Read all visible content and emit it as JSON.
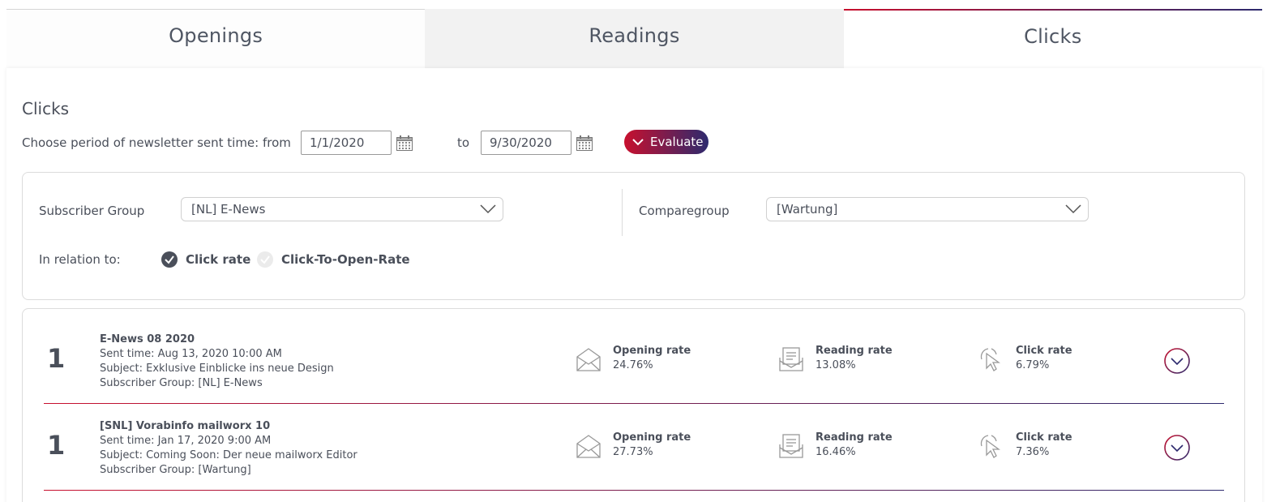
{
  "tabs": [
    {
      "label": "Openings"
    },
    {
      "label": "Readings"
    },
    {
      "label": "Clicks"
    }
  ],
  "page_title": "Clicks",
  "period": {
    "label": "Choose period of newsletter sent time:",
    "from_label": "from",
    "from_value": "1/1/2020",
    "to_label": "to",
    "to_value": "9/30/2020",
    "evaluate_label": "Evaluate"
  },
  "filter": {
    "subscriber_group_label": "Subscriber Group",
    "subscriber_group_value": "[NL] E-News",
    "comparegroup_label": "Comparegroup",
    "comparegroup_value": "[Wartung]",
    "relation_label": "In relation to:",
    "options": [
      {
        "label": "Click rate",
        "selected": true
      },
      {
        "label": "Click-To-Open-Rate",
        "selected": false
      }
    ]
  },
  "results": [
    {
      "rank": "1",
      "name": "E-News 08 2020",
      "sent_time": "Sent time: Aug 13, 2020 10:00 AM",
      "subject": "Subject: Exklusive Einblicke ins neue Design",
      "group": "Subscriber Group: [NL] E-News",
      "opening_label": "Opening rate",
      "opening_value": "24.76%",
      "reading_label": "Reading rate",
      "reading_value": "13.08%",
      "click_label": "Click rate",
      "click_value": "6.79%"
    },
    {
      "rank": "1",
      "name": "[SNL] Vorabinfo mailworx 10",
      "sent_time": "Sent time: Jan 17, 2020 9:00 AM",
      "subject": "Subject: Coming Soon: Der neue mailworx Editor",
      "group": "Subscriber Group: [Wartung]",
      "opening_label": "Opening rate",
      "opening_value": "27.73%",
      "reading_label": "Reading rate",
      "reading_value": "16.46%",
      "click_label": "Click rate",
      "click_value": "7.36%"
    }
  ],
  "colors": {
    "accent_red": "#c8102e",
    "accent_navy": "#2d2a6e",
    "text": "#4a4f5a"
  },
  "icons": [
    "calendar-icon",
    "chevron-down-icon",
    "envelope-open-icon",
    "letter-read-icon",
    "cursor-click-icon",
    "expand-circle-icon",
    "check-circle-icon"
  ]
}
